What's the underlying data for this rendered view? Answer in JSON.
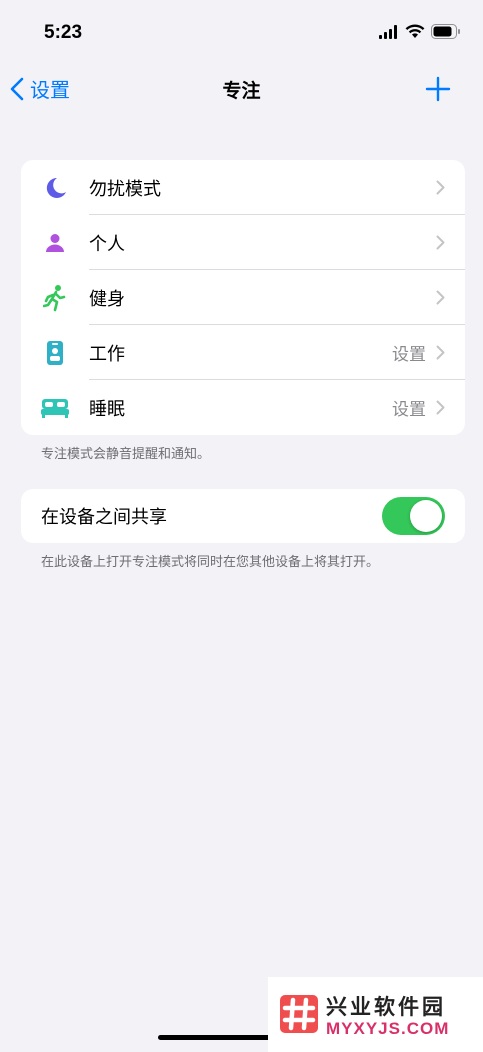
{
  "status_bar": {
    "time": "5:23"
  },
  "nav": {
    "back_label": "设置",
    "title": "专注"
  },
  "focus_modes": [
    {
      "label": "勿扰模式",
      "value": ""
    },
    {
      "label": "个人",
      "value": ""
    },
    {
      "label": "健身",
      "value": ""
    },
    {
      "label": "工作",
      "value": "设置"
    },
    {
      "label": "睡眠",
      "value": "设置"
    }
  ],
  "focus_footnote": "专注模式会静音提醒和通知。",
  "share": {
    "label": "在设备之间共享",
    "enabled": true,
    "footnote": "在此设备上打开专注模式将同时在您其他设备上将其打开。"
  },
  "watermark": {
    "title": "兴业软件园",
    "url": "MYXYJS.COM"
  },
  "colors": {
    "accent": "#007aff",
    "dnd": "#5e5ce6",
    "personal": "#af52de",
    "fitness": "#34c759",
    "work": "#30b0c7",
    "sleep": "#2ec4b6",
    "toggle_on": "#34c759"
  }
}
